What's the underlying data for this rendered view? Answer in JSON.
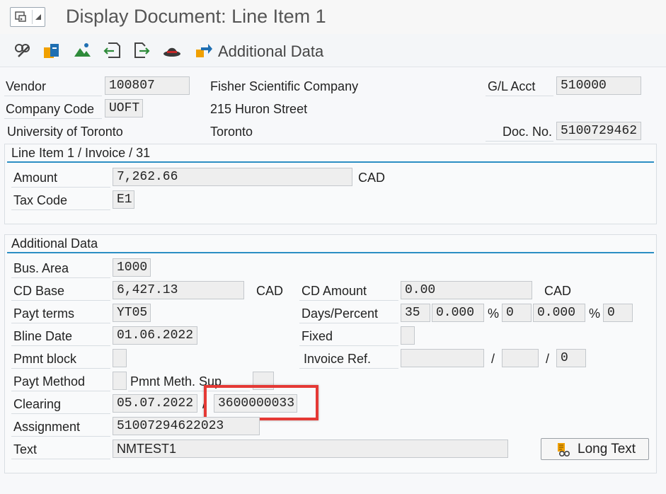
{
  "window": {
    "title": "Display Document: Line Item 1"
  },
  "toolbar": {
    "icons": [
      "display-change-icon",
      "document-icon",
      "mountain-icon",
      "previous-item-icon",
      "next-item-icon",
      "hat-icon",
      "additional-data-icon"
    ],
    "additional_data_label": "Additional Data"
  },
  "header": {
    "vendor_label": "Vendor",
    "vendor_value": "100807",
    "company_code_label": "Company Code",
    "company_code_value": "UOFT",
    "company_name": "University of Toronto",
    "vendor_name": "Fisher Scientific Company",
    "vendor_street": "215 Huron Street",
    "vendor_city": "Toronto",
    "gl_acct_label": "G/L Acct",
    "gl_acct_value": "510000",
    "doc_no_label": "Doc. No.",
    "doc_no_value": "5100729462"
  },
  "line_item": {
    "group_title": "Line Item 1 / Invoice / 31",
    "amount_label": "Amount",
    "amount_value": "7,262.66",
    "amount_currency": "CAD",
    "tax_code_label": "Tax Code",
    "tax_code_value": "E1"
  },
  "additional": {
    "group_title": "Additional Data",
    "bus_area_label": "Bus. Area",
    "bus_area_value": "1000",
    "cd_base_label": "CD Base",
    "cd_base_value": "6,427.13",
    "cd_base_currency": "CAD",
    "cd_amount_label": "CD Amount",
    "cd_amount_value": "0.00",
    "cd_amount_currency": "CAD",
    "payt_terms_label": "Payt terms",
    "payt_terms_value": "YT05",
    "days_percent_label": "Days/Percent",
    "days1": "35",
    "pct1": "0.000",
    "pct_sign": "%",
    "days2": "0",
    "pct2": "0.000",
    "days3": "0",
    "bline_label": "Bline Date",
    "bline_value": "01.06.2022",
    "fixed_label": "Fixed",
    "pmnt_block_label": "Pmnt block",
    "invoice_ref_label": "Invoice Ref.",
    "slash": "/",
    "invoice_ref_item": "0",
    "payt_method_label": "Payt Method",
    "pmnt_meth_sup_label": "Pmnt Meth. Sup",
    "clearing_label": "Clearing",
    "clearing_date": "05.07.2022",
    "clearing_doc": "3600000033",
    "assignment_label": "Assignment",
    "assignment_value": "51007294622023",
    "text_label": "Text",
    "text_value": "NMTEST1",
    "long_text_button": "Long Text"
  }
}
